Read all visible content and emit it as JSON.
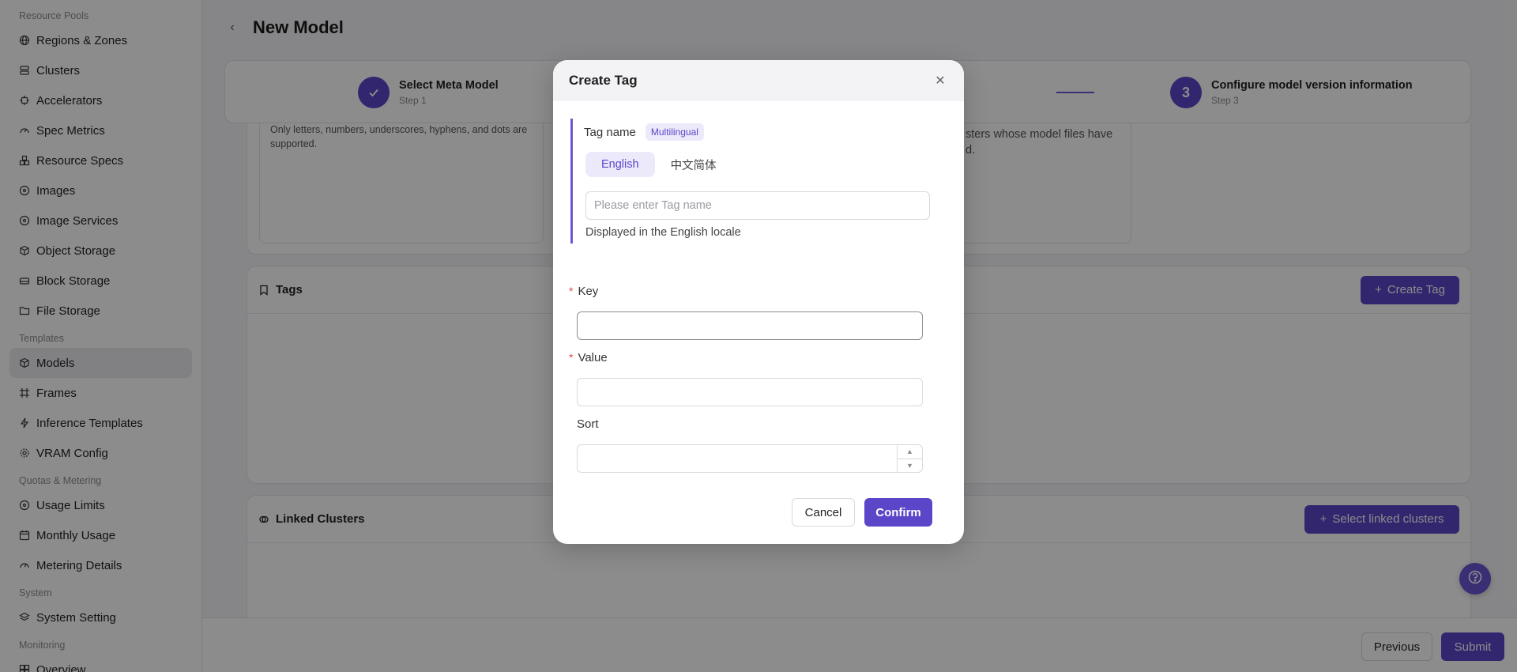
{
  "sidebar": {
    "groups": [
      {
        "label": "Resource Pools",
        "items": [
          "Regions & Zones",
          "Clusters",
          "Accelerators",
          "Spec Metrics",
          "Resource Specs",
          "Images",
          "Image Services",
          "Object Storage",
          "Block Storage",
          "File Storage"
        ]
      },
      {
        "label": "Templates",
        "items": [
          "Models",
          "Frames",
          "Inference Templates",
          "VRAM Config"
        ]
      },
      {
        "label": "Quotas & Metering",
        "items": [
          "Usage Limits",
          "Monthly Usage",
          "Metering Details"
        ]
      },
      {
        "label": "System",
        "items": [
          "System Setting"
        ]
      },
      {
        "label": "Monitoring",
        "items": [
          "Overview"
        ]
      }
    ],
    "active_item": "Models"
  },
  "header": {
    "title": "New Model"
  },
  "steps": [
    {
      "number": "",
      "title": "Select Meta Model",
      "sub": "Step 1",
      "done": true
    },
    {
      "number": "3",
      "title": "Configure model version information",
      "sub": "Step 3",
      "done": false
    }
  ],
  "info": {
    "left_text": "Only letters, numbers, underscores, hyphens, and dots are supported.",
    "right_text": "sters whose model files have\nd."
  },
  "tags_card": {
    "title": "Tags",
    "create_label": "Create Tag"
  },
  "clusters_card": {
    "title": "Linked Clusters",
    "select_label": "Select linked clusters"
  },
  "footer": {
    "previous_label": "Previous",
    "submit_label": "Submit"
  },
  "modal": {
    "title": "Create Tag",
    "tag_name_label": "Tag name",
    "multilingual_badge": "Multilingual",
    "lang_tabs": [
      "English",
      "中文简体"
    ],
    "tag_name_placeholder": "Please enter Tag name",
    "tag_name_help": "Displayed in the English locale",
    "key_label": "Key",
    "value_label": "Value",
    "sort_label": "Sort",
    "cancel_label": "Cancel",
    "confirm_label": "Confirm"
  },
  "colors": {
    "accent": "#5b46c9",
    "required": "#e5484d"
  }
}
